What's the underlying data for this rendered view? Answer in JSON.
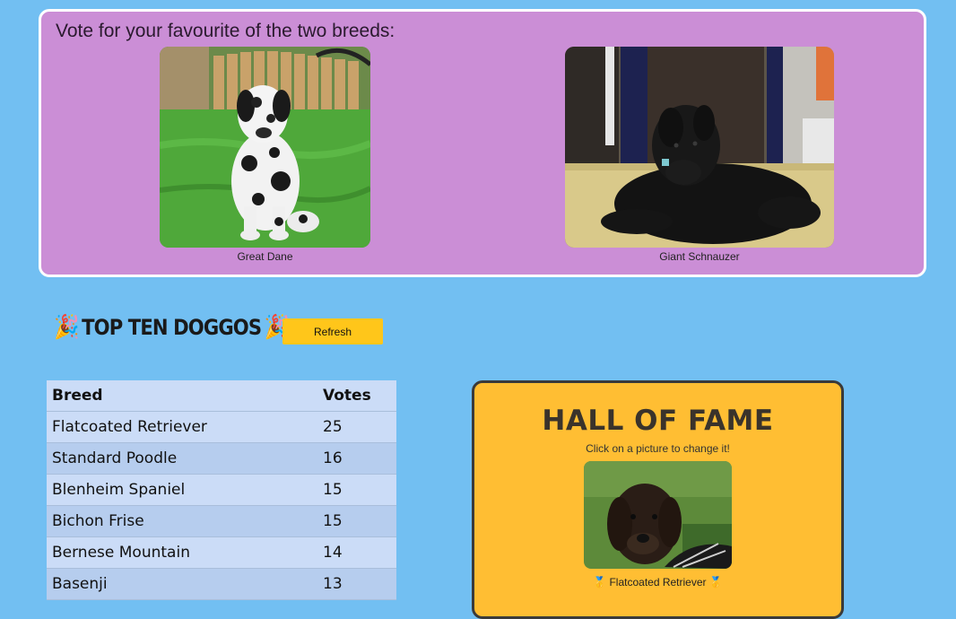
{
  "vote": {
    "heading": "Vote for your favourite of the two breeds:",
    "candidates": [
      {
        "name": "Great Dane"
      },
      {
        "name": "Giant Schnauzer"
      }
    ]
  },
  "leaderboard": {
    "title": "TOP TEN DOGGOS",
    "party_icon": "🎉",
    "refresh_label": "Refresh",
    "columns": [
      "Breed",
      "Votes"
    ],
    "rows": [
      {
        "breed": "Flatcoated Retriever",
        "votes": "25"
      },
      {
        "breed": "Standard Poodle",
        "votes": "16"
      },
      {
        "breed": "Blenheim Spaniel",
        "votes": "15"
      },
      {
        "breed": "Bichon Frise",
        "votes": "15"
      },
      {
        "breed": "Bernese Mountain",
        "votes": "14"
      },
      {
        "breed": "Basenji",
        "votes": "13"
      }
    ]
  },
  "hall_of_fame": {
    "title": "HALL OF FAME",
    "subtitle": "Click on a picture to change it!",
    "medal_icon": "🥇",
    "caption": "Flatcoated Retriever"
  },
  "colors": {
    "page_background": "#72bff2",
    "vote_panel": "#cb8ed6",
    "button": "#ffc61a",
    "hall_of_fame": "#ffbe33"
  }
}
